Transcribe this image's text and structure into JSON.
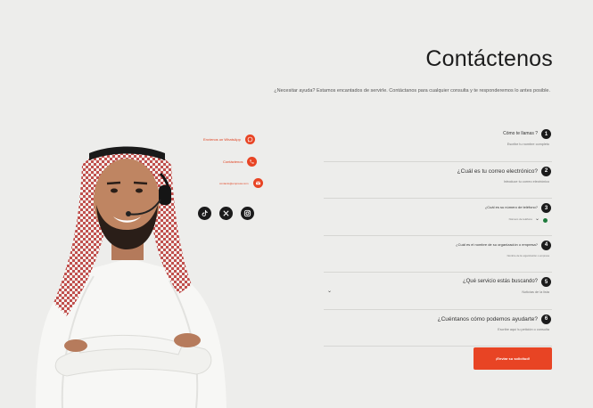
{
  "page": {
    "title": "Contáctenos",
    "subtitle": "¿Necesitar ayuda? Estamos encantados de servirle. Contáctanos para cualquier consulta y te responderemos lo antes posible."
  },
  "contacts": [
    {
      "text": "Envíenos un WhatsApp",
      "icon": "whatsapp-icon"
    },
    {
      "text": "Contáctenos",
      "icon": "phone-icon"
    },
    {
      "text": "contacto@empresa.com",
      "icon": "mail-icon"
    }
  ],
  "socials": [
    {
      "name": "tiktok",
      "icon": "tiktok-icon"
    },
    {
      "name": "x",
      "icon": "x-icon"
    },
    {
      "name": "instagram",
      "icon": "instagram-icon"
    }
  ],
  "form": {
    "questions": [
      {
        "num": "1",
        "label": "Cómo te llamas ?",
        "placeholder": "Escribe tu nombre completo"
      },
      {
        "num": "2",
        "label": "¿Cuál es tu correo electrónico?",
        "placeholder": "Introduce tu correo electrónico"
      },
      {
        "num": "3",
        "label": "¿Cuál es su número de teléfono?",
        "placeholder": "Número de teléfono"
      },
      {
        "num": "4",
        "label": "¿Cuál es el nombre de su organización o empresa?",
        "placeholder": "Nombre de la organización o empresa"
      },
      {
        "num": "5",
        "label": "¿Qué servicio estás buscando?",
        "placeholder": "Noticias de la lista"
      },
      {
        "num": "6",
        "label": "¿Cuéntanos cómo podemos ayudarte?",
        "placeholder": "Escribe aquí tu petición o consulta"
      }
    ],
    "submit_label": "¡Enviar su solicitud!"
  },
  "colors": {
    "accent": "#e84424",
    "dark": "#1b1b1b",
    "background": "#ededeb"
  }
}
